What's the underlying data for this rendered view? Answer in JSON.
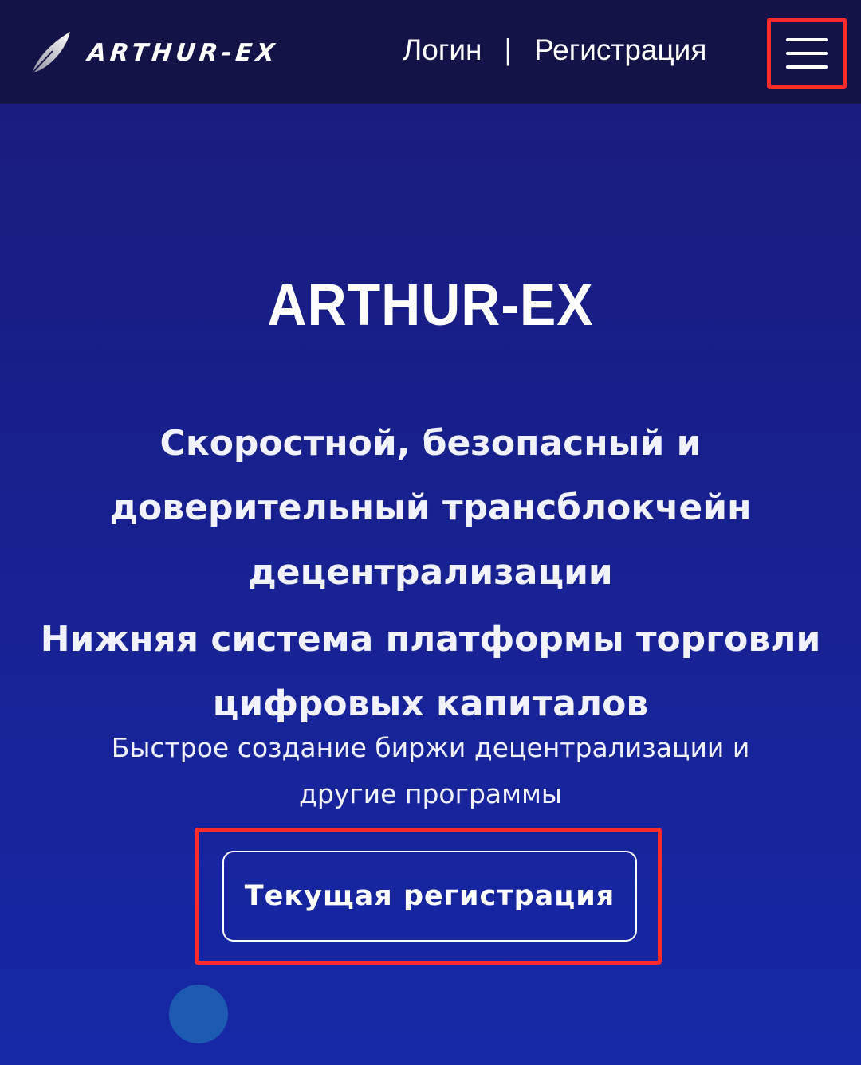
{
  "header": {
    "logo_text": "ARTHUR-EX",
    "login_label": "Логин",
    "separator": "|",
    "register_label": "Регистрация",
    "menu_icon": "hamburger-menu-icon"
  },
  "hero": {
    "title": "ARTHUR-EX",
    "subtitle_line1": "Скоростной, безопасный и",
    "subtitle_line2": "доверительный трансблокчейн",
    "subtitle_line3": "децентрализации",
    "subtitle2_line1": "Нижняя система платформы торговли",
    "subtitle2_line2": "цифровых капиталов",
    "desc_line1": "Быстрое создание биржи децентрализации и",
    "desc_line2": "другие программы",
    "cta_label": "Текущая регистрация"
  },
  "colors": {
    "topbar_bg": "#141347",
    "hero_bg_top": "#1a1a78",
    "hero_bg_bottom": "#1628a6",
    "highlight": "#ff2a2a",
    "text": "#ffffff"
  }
}
